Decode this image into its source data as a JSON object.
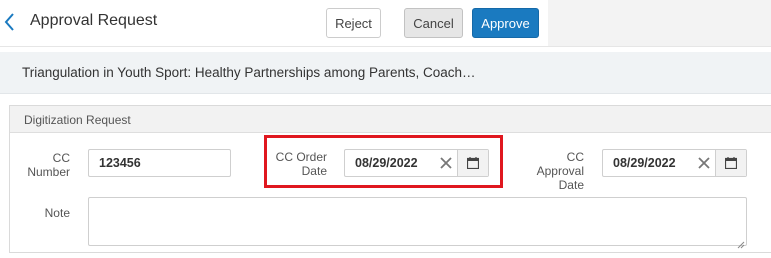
{
  "header": {
    "title": "Approval Request",
    "back_icon": "chevron-left-icon",
    "buttons": {
      "reject": "Reject",
      "cancel": "Cancel",
      "approve": "Approve"
    },
    "colors": {
      "approve_bg": "#1a7ac0"
    }
  },
  "record": {
    "title": "Triangulation in Youth Sport: Healthy Partnerships among Parents, Coach…"
  },
  "panel": {
    "title": "Digitization Request",
    "fields": {
      "cc_number": {
        "label_line1": "CC",
        "label_line2": "Number",
        "value": "123456"
      },
      "cc_order_date": {
        "label_line1": "CC Order",
        "label_line2": "Date",
        "value": "08/29/2022"
      },
      "cc_approval_date": {
        "label_line1": "CC",
        "label_line2": "Approval",
        "label_line3": "Date",
        "value": "08/29/2022"
      },
      "note": {
        "label": "Note",
        "value": ""
      }
    },
    "icons": {
      "clear": "close-icon",
      "calendar": "calendar-icon"
    }
  },
  "highlight": {
    "color": "#e0171f",
    "target": "cc_order_date"
  }
}
